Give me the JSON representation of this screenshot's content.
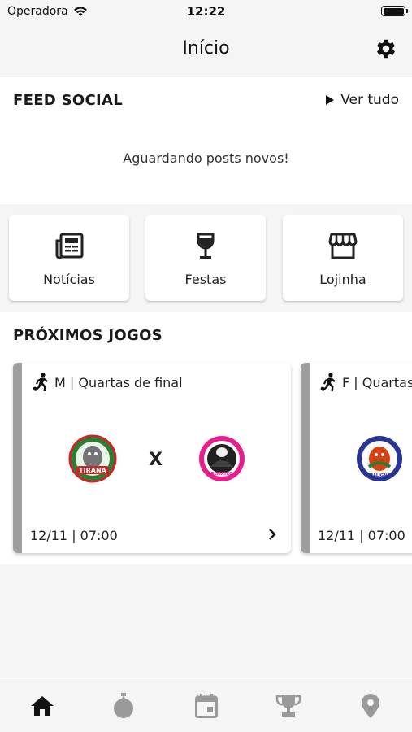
{
  "status_bar": {
    "carrier": "Operadora",
    "time": "12:22"
  },
  "header": {
    "title": "Início",
    "settings_icon": "gear-icon"
  },
  "feed": {
    "title": "FEED SOCIAL",
    "see_all": "Ver tudo",
    "empty_message": "Aguardando posts novos!"
  },
  "shortcuts": [
    {
      "label": "Notícias",
      "icon": "newspaper-icon"
    },
    {
      "label": "Festas",
      "icon": "wine-glass-icon"
    },
    {
      "label": "Lojinha",
      "icon": "storefront-icon"
    }
  ],
  "games": {
    "title": "PRÓXIMOS JOGOS",
    "cards": [
      {
        "gender": "M",
        "stage": "Quartas de final",
        "header": "M | Quartas de final",
        "home_team_text": "TIRANA",
        "vs": "X",
        "away_team_text": "REMATEQ",
        "date": "12/11 | 07:00",
        "stripe_color": "#9e9e9e"
      },
      {
        "gender": "F",
        "stage": "Quartas de final",
        "header": "F | Quartas de final",
        "home_team_text": "MALIGNA",
        "date": "12/11 | 07:00",
        "stripe_color": "#9e9e9e"
      }
    ]
  },
  "tabs": [
    {
      "icon": "home-icon",
      "active": true
    },
    {
      "icon": "ball-icon",
      "active": false
    },
    {
      "icon": "calendar-icon",
      "active": false
    },
    {
      "icon": "trophy-icon",
      "active": false
    },
    {
      "icon": "map-pin-icon",
      "active": false
    }
  ],
  "colors": {
    "active_tab": "#111111",
    "inactive_tab": "#9a9a9a",
    "card_stripe": "#9e9e9e",
    "background": "#f5f5f5"
  }
}
